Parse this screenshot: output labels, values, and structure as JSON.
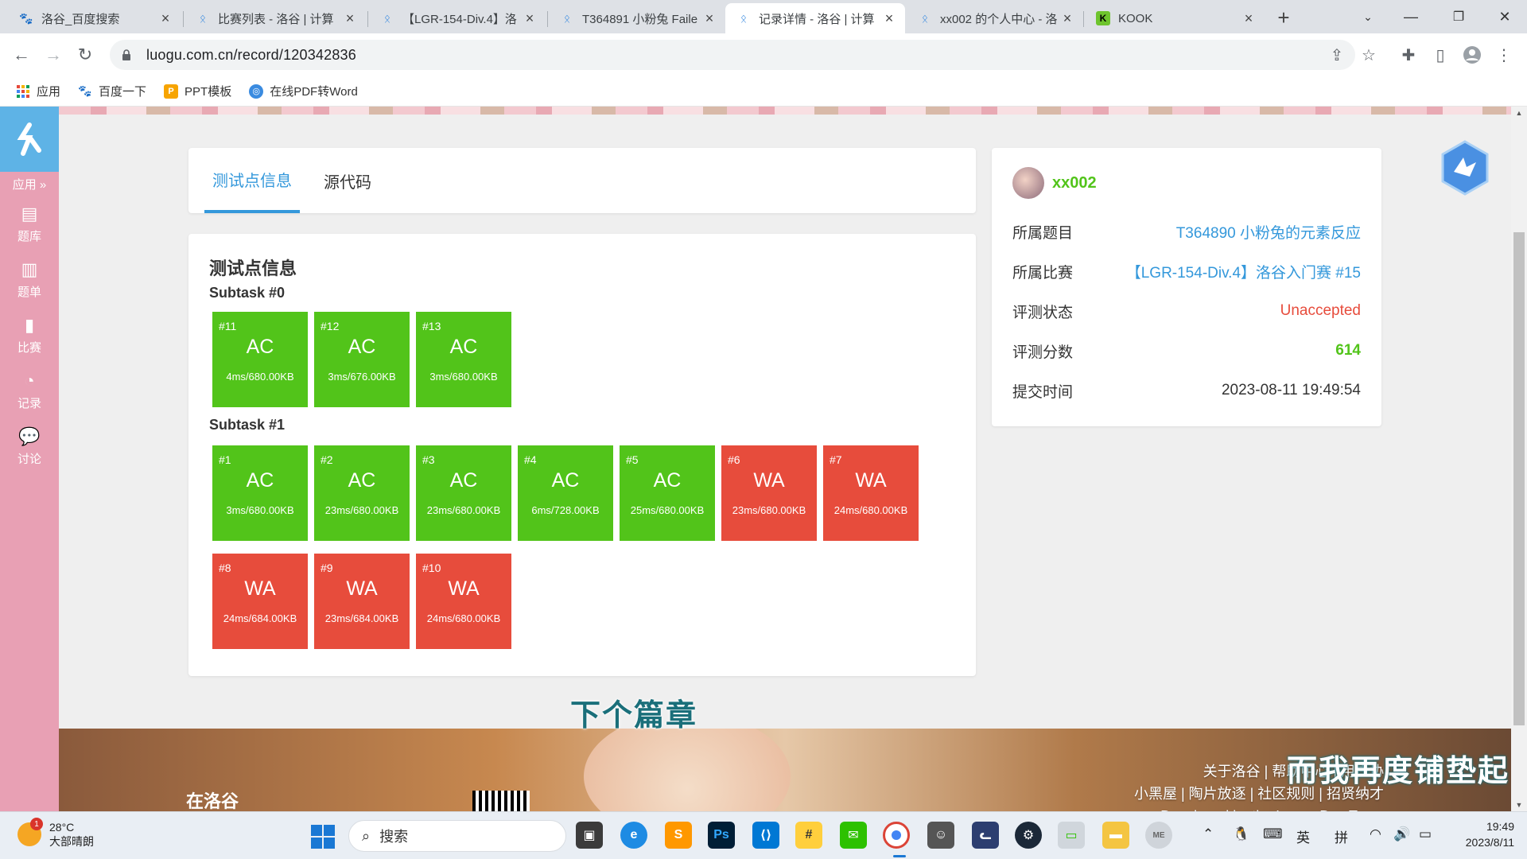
{
  "browser": {
    "tabs": [
      {
        "title": "洛谷_百度搜索"
      },
      {
        "title": "比赛列表 - 洛谷 | 计算"
      },
      {
        "title": "【LGR-154-Div.4】洛"
      },
      {
        "title": "T364891 小粉兔 Faile"
      },
      {
        "title": "记录详情 - 洛谷 | 计算"
      },
      {
        "title": "xx002 的个人中心 - 洛"
      },
      {
        "title": "KOOK"
      }
    ],
    "url": "luogu.com.cn/record/120342836",
    "bookmarks": [
      {
        "label": "应用"
      },
      {
        "label": "百度一下"
      },
      {
        "label": "PPT模板"
      },
      {
        "label": "在线PDF转Word"
      }
    ]
  },
  "sidebar": {
    "app_label": "应用 »",
    "items": [
      {
        "label": "题库"
      },
      {
        "label": "题单"
      },
      {
        "label": "比赛"
      },
      {
        "label": "记录"
      },
      {
        "label": "讨论"
      }
    ]
  },
  "page_tabs": {
    "tab1": "测试点信息",
    "tab2": "源代码"
  },
  "tests": {
    "title": "测试点信息",
    "subtasks": [
      {
        "name": "Subtask #0",
        "cases": [
          {
            "id": "#11",
            "status": "AC",
            "usage": "4ms/680.00KB"
          },
          {
            "id": "#12",
            "status": "AC",
            "usage": "3ms/676.00KB"
          },
          {
            "id": "#13",
            "status": "AC",
            "usage": "3ms/680.00KB"
          }
        ]
      },
      {
        "name": "Subtask #1",
        "cases": [
          {
            "id": "#1",
            "status": "AC",
            "usage": "3ms/680.00KB"
          },
          {
            "id": "#2",
            "status": "AC",
            "usage": "23ms/680.00KB"
          },
          {
            "id": "#3",
            "status": "AC",
            "usage": "23ms/680.00KB"
          },
          {
            "id": "#4",
            "status": "AC",
            "usage": "6ms/728.00KB"
          },
          {
            "id": "#5",
            "status": "AC",
            "usage": "25ms/680.00KB"
          },
          {
            "id": "#6",
            "status": "WA",
            "usage": "23ms/680.00KB"
          },
          {
            "id": "#7",
            "status": "WA",
            "usage": "24ms/680.00KB"
          },
          {
            "id": "#8",
            "status": "WA",
            "usage": "24ms/684.00KB"
          },
          {
            "id": "#9",
            "status": "WA",
            "usage": "23ms/684.00KB"
          },
          {
            "id": "#10",
            "status": "WA",
            "usage": "24ms/680.00KB"
          }
        ]
      }
    ]
  },
  "record": {
    "username": "xx002",
    "rows": [
      {
        "key": "所属题目",
        "value": "T364890 小粉兔的元素反应",
        "color": "#3498db"
      },
      {
        "key": "所属比赛",
        "value": "【LGR-154-Div.4】洛谷入门赛 #15",
        "color": "#3498db"
      },
      {
        "key": "评测状态",
        "value": "Unaccepted",
        "color": "#e74c3c"
      },
      {
        "key": "评测分数",
        "value": "614",
        "color": "#52c41a"
      },
      {
        "key": "提交时间",
        "value": "2023-08-11 19:49:54",
        "color": "#333333"
      }
    ]
  },
  "footer": {
    "links_line1": "关于洛谷 | 帮助中心 | 用户协",
    "links_line2": "小黑屋 | 陶片放逐 | 社区规则 | 招贤纳才",
    "links_line3": "Developed by the Luogu Dev Team",
    "logo_text": "在洛谷"
  },
  "video_subtitles": {
    "line1": "下个篇章",
    "line2": "而我再度铺垫起"
  },
  "taskbar": {
    "weather_temp": "28°C",
    "weather_desc": "大部晴朗",
    "weather_badge": "1",
    "search_placeholder": "搜索",
    "ime_lang": "英",
    "ime_mode": "拼",
    "time": "19:49",
    "date": "2023/8/11"
  },
  "colors": {
    "ac": "#52c41a",
    "wa": "#e74c3c",
    "link": "#3498db",
    "sidebar": "#e8a0b4"
  }
}
